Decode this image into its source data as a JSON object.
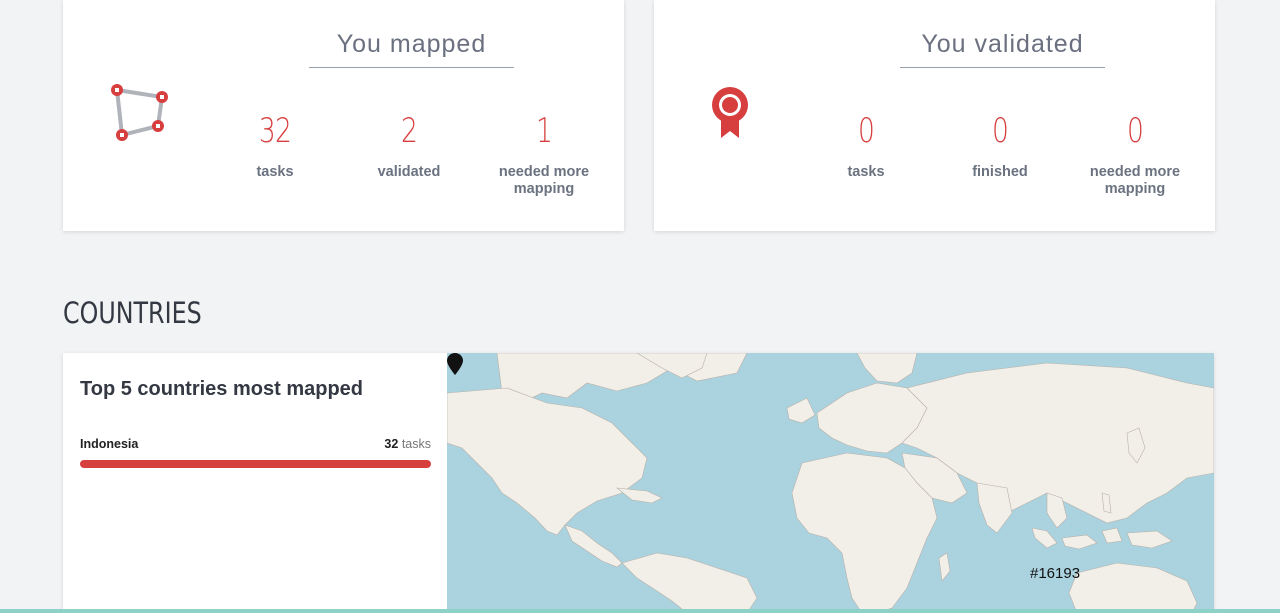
{
  "mapped": {
    "title": "You mapped",
    "stats": [
      {
        "value": "32",
        "label": "tasks"
      },
      {
        "value": "2",
        "label": "validated"
      },
      {
        "value": "1",
        "label": "needed more mapping"
      }
    ]
  },
  "validated": {
    "title": "You validated",
    "stats": [
      {
        "value": "0",
        "label": "tasks"
      },
      {
        "value": "0",
        "label": "finished"
      },
      {
        "value": "0",
        "label": "needed more mapping"
      }
    ]
  },
  "countries": {
    "heading": "COUNTRIES",
    "panel_title": "Top 5 countries most mapped",
    "top": [
      {
        "name": "Indonesia",
        "count": "32",
        "unit": "tasks",
        "share": 1.0
      }
    ]
  },
  "map": {
    "marker_label": "#16193"
  },
  "colors": {
    "accent": "#d73f3f",
    "water": "#aad3df",
    "land": "#f2efe9"
  },
  "icons": {
    "mapped": "polygon-nodes-icon",
    "validated": "award-ribbon-icon",
    "marker": "map-pin-icon"
  }
}
